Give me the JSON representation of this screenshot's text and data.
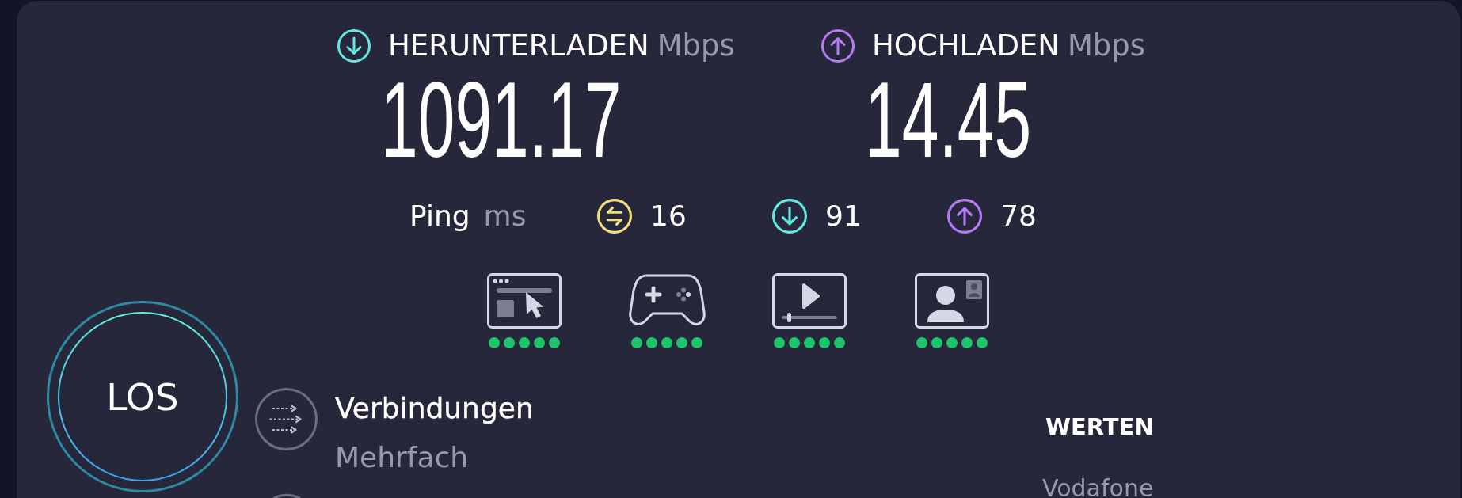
{
  "results": [
    {
      "kind": "download",
      "label": "HERUNTERLADEN",
      "unit": "Mbps",
      "value": "1091.17"
    },
    {
      "kind": "upload",
      "label": "HOCHLADEN",
      "unit": "Mbps",
      "value": "14.45"
    }
  ],
  "ping": {
    "label": "Ping",
    "unit": "ms",
    "metrics": [
      {
        "kind": "idle",
        "value": "16"
      },
      {
        "kind": "download",
        "value": "91"
      },
      {
        "kind": "upload",
        "value": "78"
      }
    ]
  },
  "activities": [
    {
      "kind": "browsing",
      "stars": 5
    },
    {
      "kind": "gaming",
      "stars": 5
    },
    {
      "kind": "streaming",
      "stars": 5
    },
    {
      "kind": "video_call",
      "stars": 5
    }
  ],
  "start_button": {
    "label": "LOS"
  },
  "connections": {
    "label": "Verbindungen",
    "value": "Mehrfach"
  },
  "provider": {
    "heading": "WERTEN",
    "name": "Vodafone"
  }
}
